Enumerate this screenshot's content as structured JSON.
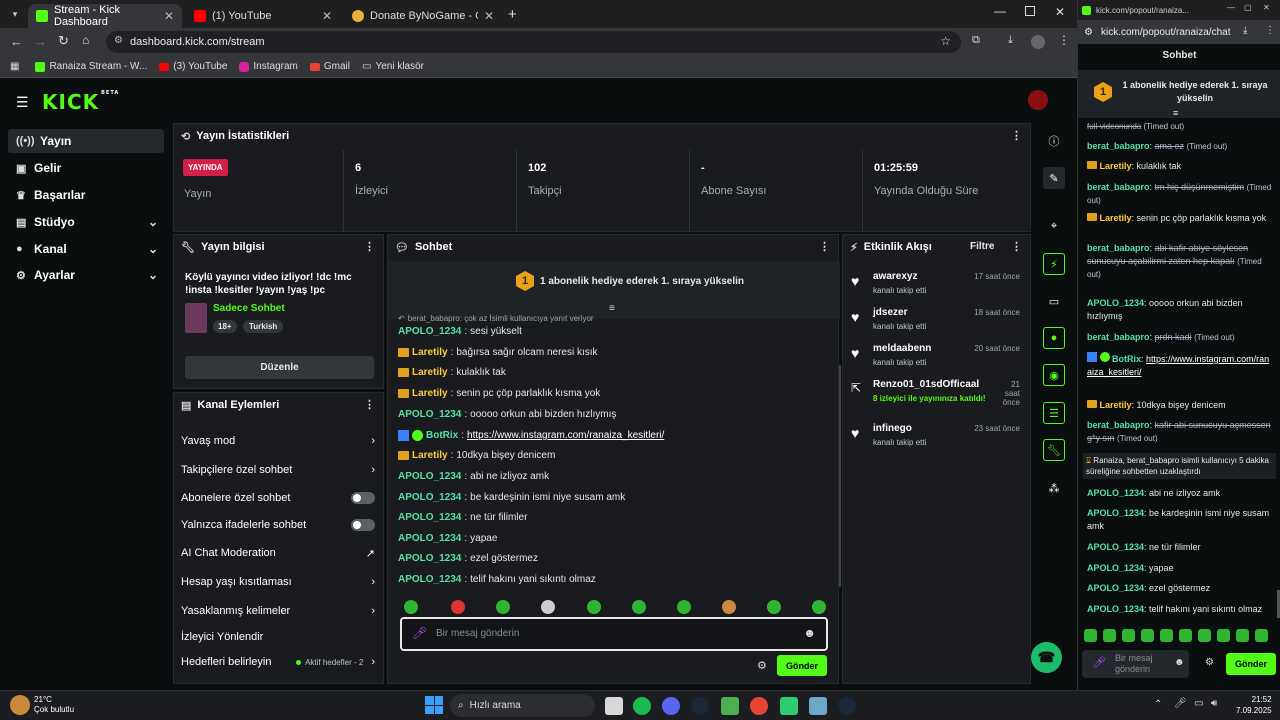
{
  "browser": {
    "tabs": [
      {
        "title": "Stream - Kick Dashboard"
      },
      {
        "title": "(1) YouTube"
      },
      {
        "title": "Donate ByNoGame - Gelen/Gi..."
      }
    ],
    "url": "dashboard.kick.com/stream",
    "bookmarks": [
      "Ranaiza Stream - W...",
      "(3) YouTube",
      "Instagram",
      "Gmail",
      "Yeni klasör"
    ]
  },
  "brand": {
    "logo": "KICK",
    "beta": "BETA",
    "accent": "#53fc18"
  },
  "sidebar": {
    "items": [
      {
        "label": "Yayın",
        "icon": "stream-icon"
      },
      {
        "label": "Gelir",
        "icon": "wallet-icon"
      },
      {
        "label": "Başarılar",
        "icon": "trophy-icon"
      },
      {
        "label": "Stüdyo",
        "icon": "studio-icon"
      },
      {
        "label": "Kanal",
        "icon": "user-icon"
      },
      {
        "label": "Ayarlar",
        "icon": "gear-icon"
      }
    ]
  },
  "stats": {
    "title": "Yayın İstatistikleri",
    "badge": "YAYINDA",
    "badge_label": "Yayın",
    "cells": [
      {
        "value": "6",
        "label": "İzleyici"
      },
      {
        "value": "102",
        "label": "Takipçi"
      },
      {
        "value": "-",
        "label": "Abone Sayısı"
      },
      {
        "value": "01:25:59",
        "label": "Yayında Olduğu Süre"
      }
    ]
  },
  "info": {
    "title": "Yayın bilgisi",
    "stream_title": "Köylü yayıncı video izliyor! !dc !mc !insta !kesitler !yayın !yaş !pc",
    "category": "Sadece Sohbet",
    "tags": [
      "18+",
      "Turkish"
    ],
    "edit": "Düzenle"
  },
  "actions": {
    "title": "Kanal Eylemleri",
    "items": [
      "Yavaş mod",
      "Takipçilere özel sohbet",
      "Abonelere özel sohbet",
      "Yalnızca ifadelerle sohbet",
      "AI Chat Moderation",
      "Hesap yaşı kısıtlaması",
      "Yasaklanmış kelimeler",
      "İzleyici Yönlendir",
      "Hedefleri belirleyin"
    ],
    "goal_status": "Aktif hedefler - 2"
  },
  "chat": {
    "title": "Sohbet",
    "pinned": "1 abonelik hediye ederek 1. sıraya yükselin",
    "pinned_num": "1",
    "reply_note": "berat_babapro: çok az İsimli kullanıcıya yanıt veriyor",
    "messages": [
      {
        "user": "APOLO_1234",
        "text": "sesi yükselt",
        "type": "g"
      },
      {
        "user": "Laretily",
        "text": "bağırsa sağır olcam neresi kısık",
        "type": "y"
      },
      {
        "user": "Laretily",
        "text": "kulaklık tak",
        "type": "y"
      },
      {
        "user": "Laretily",
        "text": "senin pc çöp parlaklık kısma yok",
        "type": "y"
      },
      {
        "user": "APOLO_1234",
        "text": "ooooo orkun abi bizden hızlıymış",
        "type": "g"
      },
      {
        "user": "BotRix",
        "text": "https://www.instagram.com/ranaiza_kesitleri/",
        "type": "b"
      },
      {
        "user": "Laretily",
        "text": "10dkya bişey denicem",
        "type": "y"
      },
      {
        "user": "APOLO_1234",
        "text": "abi ne izliyoz amk",
        "type": "g"
      },
      {
        "user": "APOLO_1234",
        "text": "be kardeşinin ismi niye susam amk",
        "type": "g"
      },
      {
        "user": "APOLO_1234",
        "text": "ne tür filimler",
        "type": "g"
      },
      {
        "user": "APOLO_1234",
        "text": "yapae",
        "type": "g"
      },
      {
        "user": "APOLO_1234",
        "text": "ezel göstermez",
        "type": "g"
      },
      {
        "user": "APOLO_1234",
        "text": "telif hakını yani sıkıntı olmaz",
        "type": "g"
      }
    ],
    "placeholder": "Bir mesaj gönderin",
    "send": "Gönder"
  },
  "activity": {
    "title": "Etkinlik Akışı",
    "filter": "Filtre",
    "items": [
      {
        "name": "awarexyz",
        "sub": "kanalı takip etti",
        "time": "17 saat önce"
      },
      {
        "name": "jdsezer",
        "sub": "kanalı takip etti",
        "time": "18 saat önce"
      },
      {
        "name": "meldaabenn",
        "sub": "kanalı takip etti",
        "time": "20 saat önce"
      },
      {
        "name": "Renzo01_01sdOfficaal",
        "sub": "8 izleyici ile yayınınıza katıldı!",
        "time": "21 saat önce"
      },
      {
        "name": "infinego",
        "sub": "kanalı takip etti",
        "time": "23 saat önce"
      }
    ]
  },
  "popout": {
    "tab": "kick.com/popout/ranaiza...",
    "url": "kick.com/popout/ranaiza/chat",
    "title": "Sohbet",
    "pinned": "1 abonelik hediye ederek 1. sıraya yükselin",
    "top_fragment": "full-videonunda",
    "timed_out": "(Timed out)",
    "messages": [
      {
        "user": "berat_babapro",
        "text": "ama ez",
        "strike": true
      },
      {
        "user": "Laretily",
        "text": "kulaklık tak",
        "type": "y"
      },
      {
        "user": "berat_babapro",
        "text": "tm hiç düşünmemiştim",
        "strike": true
      },
      {
        "user": "Laretily",
        "text": "senin pc çöp parlaklık kısma yok",
        "type": "y"
      },
      {
        "user": "berat_babapro",
        "text": "abi kafir abiye söylesen sunucuyu açabilirmi zaten hep kapalı",
        "strike": true
      },
      {
        "user": "APOLO_1234",
        "text": "ooooo orkun abi bizden hızlıymış"
      },
      {
        "user": "berat_babapro",
        "text": "prdn kadi",
        "strike": true
      },
      {
        "user": "BotRix",
        "text": "https://www.instagram.com/ranaiza_kesitleri/",
        "type": "b"
      },
      {
        "user": "Laretily",
        "text": "10dkya bişey denicem",
        "type": "y"
      },
      {
        "user": "berat_babapro",
        "text": "kafir abi sunucuyu açmessen g*y sın",
        "strike": true
      },
      {
        "user": "",
        "text": "Ranaiza, berat_babapro isimli kullanıcıyı 5 dakika süreliğine sohbetten uzaklaştırdı",
        "type": "sys"
      },
      {
        "user": "APOLO_1234",
        "text": "abi ne izliyoz amk"
      },
      {
        "user": "APOLO_1234",
        "text": "be kardeşinin ismi niye susam amk"
      },
      {
        "user": "APOLO_1234",
        "text": "ne tür filimler"
      },
      {
        "user": "APOLO_1234",
        "text": "yapae"
      },
      {
        "user": "APOLO_1234",
        "text": "ezel göstermez"
      },
      {
        "user": "APOLO_1234",
        "text": "telif hakını yani sıkıntı olmaz"
      }
    ],
    "placeholder": "Bir mesaj gönderin",
    "send": "Gönder"
  },
  "taskbar": {
    "weather_temp": "21°C",
    "weather_desc": "Çok bulutlu",
    "search": "Hızlı arama",
    "time": "21:52",
    "date": "7.09.2025"
  }
}
